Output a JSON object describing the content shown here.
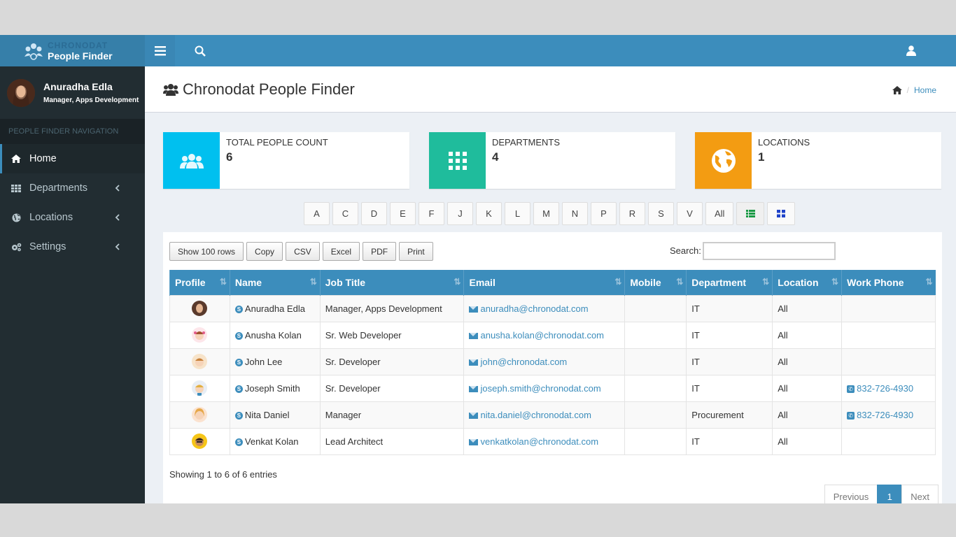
{
  "brand": {
    "line1": "CHRONODAT",
    "line2": "People Finder"
  },
  "user": {
    "name": "Anuradha Edla",
    "role": "Manager, Apps Development"
  },
  "sidebar": {
    "header": "PEOPLE FINDER NAVIGATION",
    "items": [
      {
        "label": "Home",
        "icon": "home-icon",
        "active": true
      },
      {
        "label": "Departments",
        "icon": "grid-icon"
      },
      {
        "label": "Locations",
        "icon": "globe-icon"
      },
      {
        "label": "Settings",
        "icon": "gears-icon"
      }
    ]
  },
  "page": {
    "title": "Chronodat People Finder",
    "breadcrumb": "Home"
  },
  "stats": [
    {
      "label": "TOTAL PEOPLE COUNT",
      "value": "6",
      "color": "#00c0ef",
      "icon": "users-icon"
    },
    {
      "label": "DEPARTMENTS",
      "value": "4",
      "color": "#1fbc9c",
      "icon": "grid-icon"
    },
    {
      "label": "LOCATIONS",
      "value": "1",
      "color": "#f39c12",
      "icon": "globe-icon"
    }
  ],
  "alphabet": [
    "A",
    "C",
    "D",
    "E",
    "F",
    "J",
    "K",
    "L",
    "M",
    "N",
    "P",
    "R",
    "S",
    "V",
    "All"
  ],
  "tools": [
    "Show 100 rows",
    "Copy",
    "CSV",
    "Excel",
    "PDF",
    "Print"
  ],
  "search_label": "Search:",
  "columns": [
    "Profile",
    "Name",
    "Job Title",
    "Email",
    "Mobile",
    "Department",
    "Location",
    "Work Phone"
  ],
  "rows": [
    {
      "name": "Anuradha Edla",
      "title": "Manager, Apps Development",
      "email": "anuradha@chronodat.com",
      "mobile": "",
      "dept": "IT",
      "loc": "All",
      "phone": ""
    },
    {
      "name": "Anusha Kolan",
      "title": "Sr. Web Developer",
      "email": "anusha.kolan@chronodat.com",
      "mobile": "",
      "dept": "IT",
      "loc": "All",
      "phone": ""
    },
    {
      "name": "John Lee",
      "title": "Sr. Developer",
      "email": "john@chronodat.com",
      "mobile": "",
      "dept": "IT",
      "loc": "All",
      "phone": ""
    },
    {
      "name": "Joseph Smith",
      "title": "Sr. Developer",
      "email": "joseph.smith@chronodat.com",
      "mobile": "",
      "dept": "IT",
      "loc": "All",
      "phone": "832-726-4930"
    },
    {
      "name": "Nita Daniel",
      "title": "Manager",
      "email": "nita.daniel@chronodat.com",
      "mobile": "",
      "dept": "Procurement",
      "loc": "All",
      "phone": "832-726-4930"
    },
    {
      "name": "Venkat Kolan",
      "title": "Lead Architect",
      "email": "venkatkolan@chronodat.com",
      "mobile": "",
      "dept": "IT",
      "loc": "All",
      "phone": ""
    }
  ],
  "footer": {
    "info": "Showing 1 to 6 of 6 entries",
    "prev": "Previous",
    "page": "1",
    "next": "Next"
  }
}
